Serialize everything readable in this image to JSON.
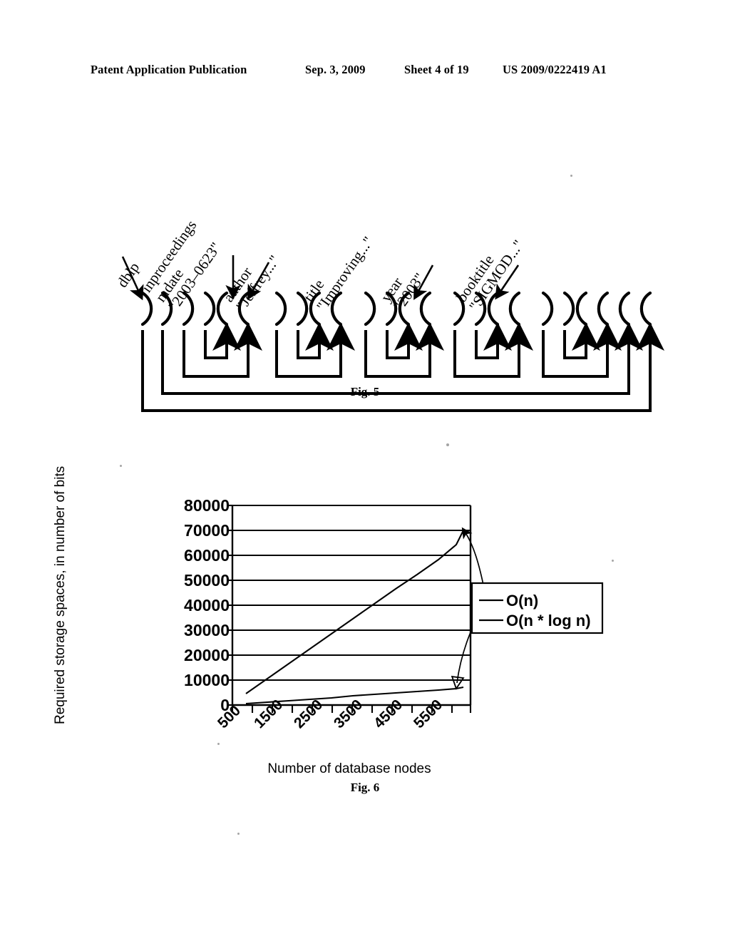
{
  "header": {
    "publication": "Patent Application Publication",
    "date": "Sep. 3, 2009",
    "sheet": "Sheet 4 of 19",
    "number": "US 2009/0222419 A1"
  },
  "figure5": {
    "caption": "Fig. 5",
    "description": "Balanced parentheses encoding of an XML tree with matching-bracket arrows",
    "labels": [
      {
        "line1": "dblp",
        "line2": ""
      },
      {
        "line1": "inproceedings",
        "line2": ""
      },
      {
        "line1": "mdate",
        "line2": "\"2003–0623\""
      },
      {
        "line1": "author",
        "line2": "\"Jeffrey...\""
      },
      {
        "line1": "title",
        "line2": "\"Improving...\""
      },
      {
        "line1": "year",
        "line2": "\"2003\""
      },
      {
        "line1": "booktitle",
        "line2": "\"SIGMOD...\""
      }
    ],
    "sequence": "( ( ( ( ) ) ( ( ) ) ( ( ) ) ( ( ) ) ( ( ) ) ) )"
  },
  "figure6": {
    "caption": "Fig. 6"
  },
  "chart_data": {
    "type": "line",
    "title": "",
    "xlabel": "Number of database nodes",
    "ylabel": "Required storage spaces, in number of bits",
    "xlim": [
      0,
      6000
    ],
    "ylim": [
      0,
      80000
    ],
    "ytick_labels": [
      "80000",
      "70000",
      "60000",
      "50000",
      "40000",
      "30000",
      "20000",
      "10000",
      "0"
    ],
    "ytick_values": [
      80000,
      70000,
      60000,
      50000,
      40000,
      30000,
      20000,
      10000,
      0
    ],
    "xtick_labels": [
      "500",
      "1500",
      "2500",
      "3500",
      "4500",
      "5500"
    ],
    "xtick_values": [
      500,
      1500,
      2500,
      3500,
      4500,
      5500
    ],
    "xtick_minor_values": [
      1000,
      2000,
      3000,
      4000,
      5000,
      6000
    ],
    "grid": "horizontal",
    "legend_position": "right-inside",
    "x": [
      500,
      1000,
      1500,
      2000,
      2500,
      3000,
      3500,
      4000,
      4500,
      5000,
      5500,
      6000
    ],
    "series": [
      {
        "name": "O(n)",
        "values": [
          700,
          1300,
          1900,
          2500,
          3100,
          3800,
          4400,
          5100,
          5800,
          6500,
          7300,
          8000
        ]
      },
      {
        "name": "O(n * log n)",
        "values": [
          4500,
          10500,
          16500,
          22500,
          28500,
          34500,
          40500,
          46500,
          52500,
          58500,
          64500,
          70000
        ]
      }
    ],
    "annotations": [
      {
        "text": "",
        "target": "O(n * log n) curve end",
        "style": "curved-arrow-filled"
      },
      {
        "text": "",
        "target": "O(n) curve end",
        "style": "curved-arrow-hollow"
      }
    ]
  }
}
